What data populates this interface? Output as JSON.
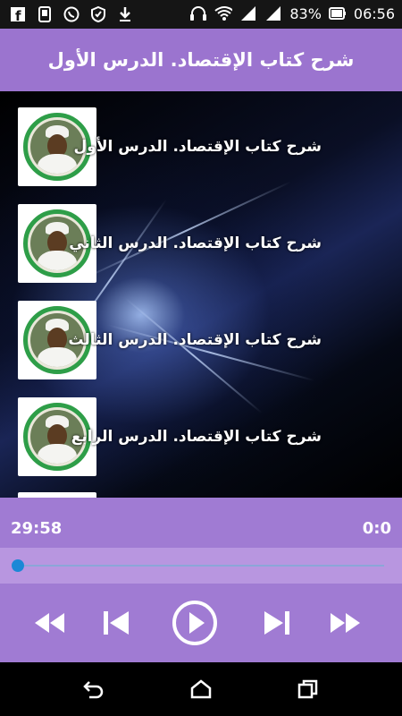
{
  "status_bar": {
    "battery_percent": "83%",
    "time": "06:56",
    "left_icons": [
      "facebook-icon",
      "phone-screen-icon",
      "whatsapp-icon",
      "shield-icon",
      "download-icon"
    ],
    "right_icons": [
      "headphones-icon",
      "wifi-icon",
      "signal-icon",
      "signal-icon",
      "battery-icon"
    ]
  },
  "app": {
    "title": "شرح كتاب الإقتصاد. الدرس الأول"
  },
  "lessons": [
    {
      "label": "شرح كتاب الإقتصاد. الدرس الأول"
    },
    {
      "label": "شرح كتاب الإقتصاد. الدرس الثاني"
    },
    {
      "label": "شرح كتاب الإقتصاد. الدرس الثالث"
    },
    {
      "label": "شرح كتاب الإقتصاد. الدرس الرابع"
    }
  ],
  "player": {
    "duration": "29:58",
    "position": "0:0",
    "progress": 0,
    "controls": [
      "rewind-icon",
      "previous-icon",
      "play-icon",
      "next-icon",
      "fast-forward-icon"
    ]
  },
  "colors": {
    "accent": "#9b74cf",
    "player_bg": "#a07bd3",
    "seek_bg": "#b896e0",
    "seek_thumb": "#1b88d6"
  }
}
